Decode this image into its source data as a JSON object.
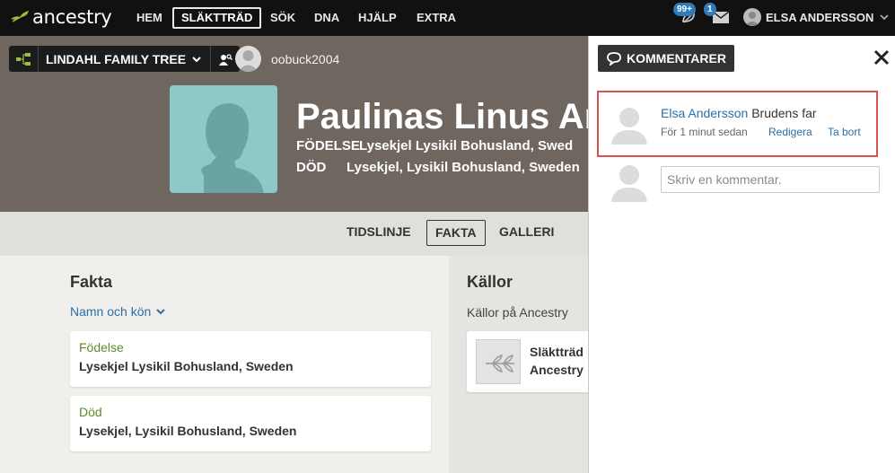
{
  "nav": {
    "logo_text": "ancestry",
    "items": [
      {
        "label": "HEM",
        "active": false
      },
      {
        "label": "SLÄKTTRÄD",
        "active": true
      },
      {
        "label": "SÖK",
        "active": false
      },
      {
        "label": "DNA",
        "active": false
      },
      {
        "label": "HJÄLP",
        "active": false
      },
      {
        "label": "EXTRA",
        "active": false
      }
    ],
    "hints_badge": "99+",
    "messages_badge": "1",
    "user_name": "ELSA ANDERSSON"
  },
  "tree_bar": {
    "tree_name": "LINDAHL FAMILY TREE",
    "owner": "oobuck2004"
  },
  "person": {
    "name": "Paulinas Linus An",
    "birth_label": "FÖDELSE",
    "birth_place": "Lysekjel Lysikil Bohusland, Swed",
    "death_label": "DÖD",
    "death_place": "Lysekjel, Lysikil Bohusland, Sweden"
  },
  "tabs": [
    {
      "label": "TIDSLINJE",
      "active": false
    },
    {
      "label": "FAKTA",
      "active": true
    },
    {
      "label": "GALLERI",
      "active": false
    }
  ],
  "facts": {
    "heading": "Fakta",
    "name_gender_link": "Namn och kön",
    "items": [
      {
        "label": "Födelse",
        "value": "Lysekjel Lysikil Bohusland, Sweden"
      },
      {
        "label": "Död",
        "value": "Lysekjel, Lysikil Bohusland, Sweden"
      }
    ]
  },
  "sources": {
    "heading": "Källor",
    "subheading": "Källor på Ancestry",
    "item_line1": "Släktträd",
    "item_line2": "Ancestry"
  },
  "comments": {
    "title": "KOMMENTARER",
    "items": [
      {
        "author": "Elsa Andersson",
        "text": "Brudens far",
        "time": "För 1 minut sedan",
        "edit": "Redigera",
        "delete": "Ta bort"
      }
    ],
    "input_placeholder": "Skriv en kommentar."
  },
  "colors": {
    "nav_bg": "#111111",
    "header_bg": "#6f6660",
    "accent_green": "#5c8a2c",
    "link_blue": "#2870a8",
    "highlight_red": "#d9534f",
    "portrait_bg": "#8ec9c9"
  }
}
